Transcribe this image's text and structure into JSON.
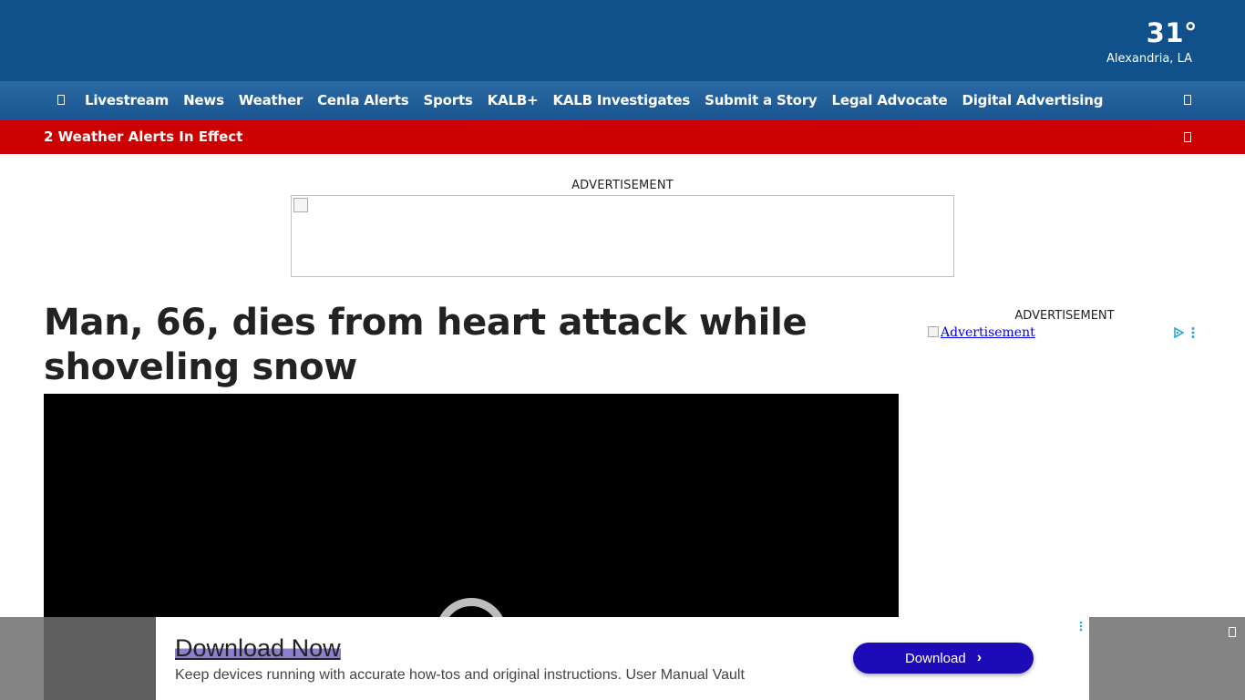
{
  "header": {
    "temperature": "31°",
    "location": "Alexandria, LA"
  },
  "nav": {
    "items": [
      "Livestream",
      "News",
      "Weather",
      "Cenla Alerts",
      "Sports",
      "KALB+",
      "KALB Investigates",
      "Submit a Story",
      "Legal Advocate",
      "Digital Advertising"
    ]
  },
  "alerts": {
    "text": "2 Weather Alerts In Effect"
  },
  "ads": {
    "top_label": "ADVERTISEMENT",
    "side_label": "ADVERTISEMENT",
    "side_alt": "Advertisement"
  },
  "article": {
    "headline": "Man, 66, dies from heart attack while shoveling snow"
  },
  "sticky_ad": {
    "title": "Download Now",
    "description": "Keep devices running with accurate how-tos and original instructions. User Manual Vault",
    "button_label": "Download",
    "button_color": "#1d0bb8"
  },
  "colors": {
    "header": "#11518b",
    "alert": "#cc0000"
  }
}
